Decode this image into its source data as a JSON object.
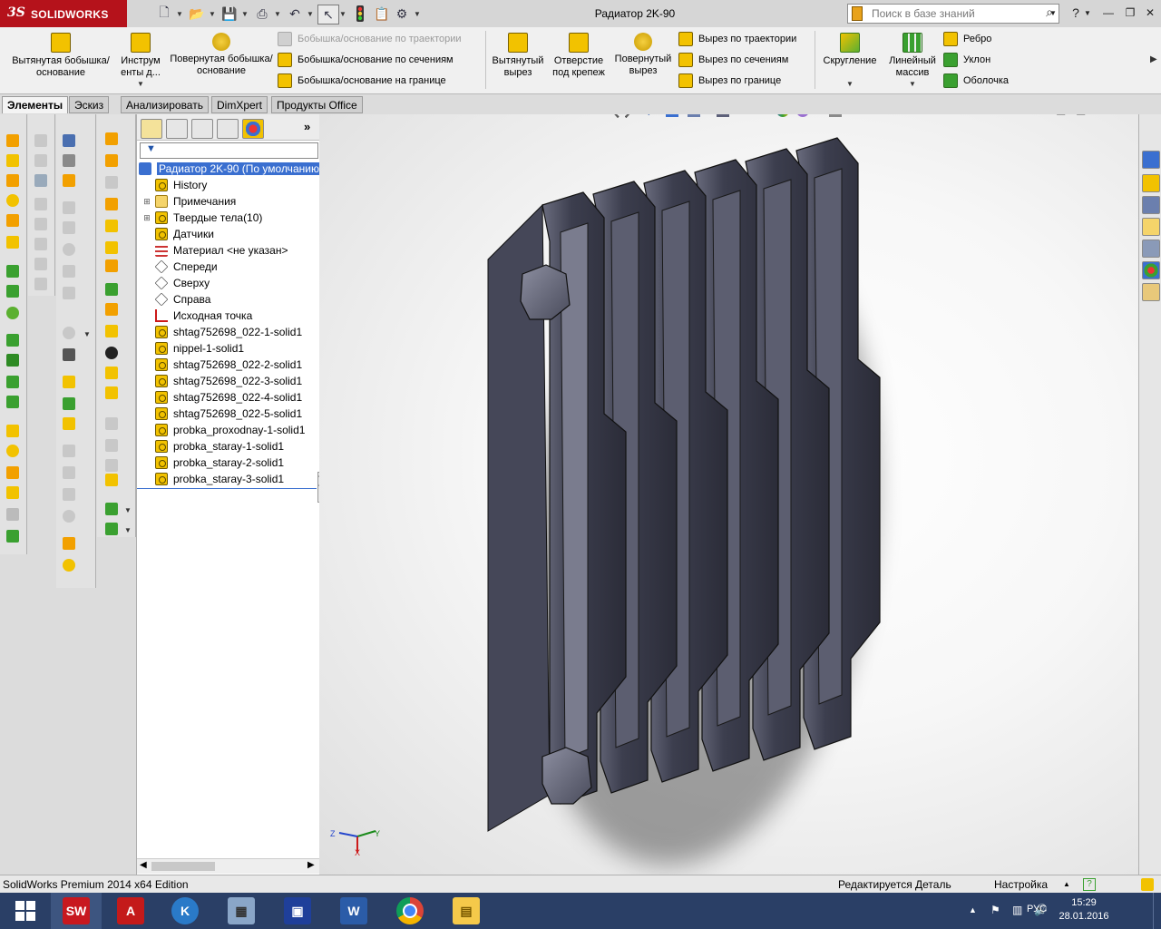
{
  "app": {
    "logo_ds": "3S",
    "logo_name": "SOLIDWORKS",
    "document_title": "Радиатор 2K-90",
    "search_placeholder": "Поиск в базе знаний",
    "help_label": "?"
  },
  "ribbon": {
    "extrude_boss": "Вытянутая бобышка/основание",
    "instant_tools": "Инструм енты д...",
    "revolve_boss": "Повернутая бобышка/основание",
    "sweep_boss": "Бобышка/основание по траектории",
    "loft_boss": "Бобышка/основание по сечениям",
    "boundary_boss": "Бобышка/основание на границе",
    "extrude_cut": "Вытянутый вырез",
    "hole_wizard": "Отверстие под крепеж",
    "revolve_cut": "Повернутый вырез",
    "sweep_cut": "Вырез по траектории",
    "loft_cut": "Вырез по сечениям",
    "boundary_cut": "Вырез по границе",
    "fillet": "Скругление",
    "linear_pattern": "Линейный массив",
    "rib": "Ребро",
    "draft": "Уклон",
    "shell": "Оболочка"
  },
  "tabs": [
    {
      "label": "Элементы",
      "active": true
    },
    {
      "label": "Эскиз",
      "active": false
    },
    {
      "label": "Анализировать",
      "active": false
    },
    {
      "label": "DimXpert",
      "active": false
    },
    {
      "label": "Продукты Office",
      "active": false
    }
  ],
  "feature_tree": {
    "root": "Радиатор 2K-90  (По умолчанию",
    "items": [
      {
        "label": "History",
        "icon": "history-icon",
        "expandable": false
      },
      {
        "label": "Примечания",
        "icon": "annotations-icon",
        "expandable": true
      },
      {
        "label": "Твердые тела(10)",
        "icon": "solid-bodies-folder-icon",
        "expandable": true
      },
      {
        "label": "Датчики",
        "icon": "sensors-icon",
        "expandable": false
      },
      {
        "label": "Материал <не указан>",
        "icon": "material-icon",
        "expandable": false
      },
      {
        "label": "Спереди",
        "icon": "plane-icon",
        "expandable": false
      },
      {
        "label": "Сверху",
        "icon": "plane-icon",
        "expandable": false
      },
      {
        "label": "Справа",
        "icon": "plane-icon",
        "expandable": false
      },
      {
        "label": "Исходная точка",
        "icon": "origin-icon",
        "expandable": false
      },
      {
        "label": "shtag752698_022-1-solid1",
        "icon": "solid-body-icon",
        "expandable": false
      },
      {
        "label": "nippel-1-solid1",
        "icon": "solid-body-icon",
        "expandable": false
      },
      {
        "label": "shtag752698_022-2-solid1",
        "icon": "solid-body-icon",
        "expandable": false
      },
      {
        "label": "shtag752698_022-3-solid1",
        "icon": "solid-body-icon",
        "expandable": false
      },
      {
        "label": "shtag752698_022-4-solid1",
        "icon": "solid-body-icon",
        "expandable": false
      },
      {
        "label": "shtag752698_022-5-solid1",
        "icon": "solid-body-icon",
        "expandable": false
      },
      {
        "label": "probka_proxodnay-1-solid1",
        "icon": "solid-body-icon",
        "expandable": false
      },
      {
        "label": "probka_staray-1-solid1",
        "icon": "solid-body-icon",
        "expandable": false
      },
      {
        "label": "probka_staray-2-solid1",
        "icon": "solid-body-icon",
        "expandable": false
      },
      {
        "label": "probka_staray-3-solid1",
        "icon": "solid-body-icon",
        "expandable": false
      }
    ]
  },
  "triad": {
    "x": "X",
    "y": "Y",
    "z": "Z"
  },
  "status": {
    "edition": "SolidWorks Premium 2014 x64 Edition",
    "mode": "Редактируется Деталь",
    "settings": "Настройка"
  },
  "taskbar": {
    "apps": [
      "windows-start",
      "solidworks",
      "autocad",
      "compass",
      "calculator",
      "save",
      "word",
      "chrome",
      "explorer"
    ],
    "lang": "РУС",
    "time": "15:29",
    "date": "28.01.2016"
  },
  "colors": {
    "brand": "#b5121b",
    "selection": "#3a6fd0",
    "body_dark": "#3c3e4e",
    "taskbar": "#2a3f66"
  }
}
